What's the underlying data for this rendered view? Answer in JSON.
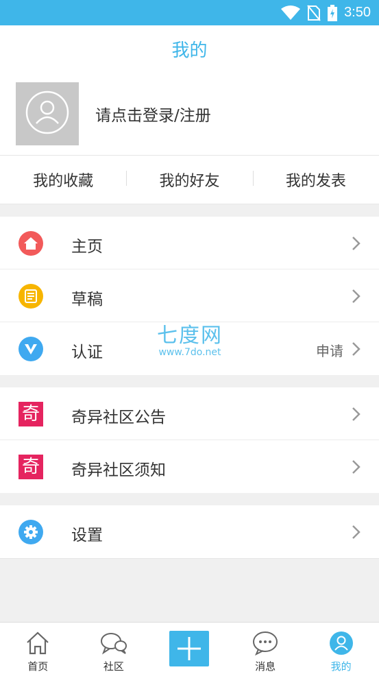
{
  "status_bar": {
    "time": "3:50",
    "icons": [
      "wifi-icon",
      "no-sim-icon",
      "battery-charging-icon"
    ]
  },
  "header": {
    "title": "我的"
  },
  "profile": {
    "login_text": "请点击登录/注册",
    "avatar_icon": "user-icon"
  },
  "quick_links": [
    {
      "label": "我的收藏"
    },
    {
      "label": "我的好友"
    },
    {
      "label": "我的发表"
    }
  ],
  "menu": {
    "group1": [
      {
        "label": "主页",
        "icon": "home-icon",
        "color": "#f25a5a"
      },
      {
        "label": "草稿",
        "icon": "draft-icon",
        "color": "#f7b500"
      },
      {
        "label": "认证",
        "icon": "verify-icon",
        "color": "#3fa9f0",
        "extra": "申请"
      }
    ],
    "group2": [
      {
        "label": "奇异社区公告",
        "icon_text": "奇",
        "color": "#e5245f"
      },
      {
        "label": "奇异社区须知",
        "icon_text": "奇",
        "color": "#e5245f"
      }
    ],
    "group3": [
      {
        "label": "设置",
        "icon": "gear-icon",
        "color": "#3fa9f0"
      }
    ]
  },
  "watermark": {
    "title": "七度网",
    "url": "www.7do.net"
  },
  "tab_bar": [
    {
      "label": "首页",
      "icon": "home-outline-icon"
    },
    {
      "label": "社区",
      "icon": "chat-bubbles-icon"
    },
    {
      "label": "",
      "icon": "plus-icon"
    },
    {
      "label": "消息",
      "icon": "message-icon"
    },
    {
      "label": "我的",
      "icon": "profile-icon",
      "active": true
    }
  ],
  "accent_color": "#3fb6e9"
}
